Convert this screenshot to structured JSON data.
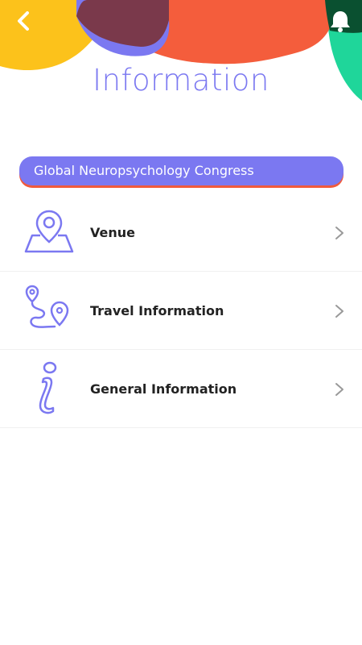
{
  "header": {
    "title": "Information",
    "colors": {
      "yellow": "#fcc21b",
      "orange": "#f45d3c",
      "purple": "#7b78f1",
      "dark": "#7a2e2e",
      "green": "#1fd69a",
      "dark_green": "#0a5030"
    },
    "back_icon": "chevron-left-icon",
    "notification_icon": "bell-icon"
  },
  "event": {
    "name": "Global Neuropsychology Congress",
    "accent": "#7b78f1",
    "underline": "#f05a3c"
  },
  "menu": {
    "items": [
      {
        "label": "Venue",
        "icon": "map-pin-icon"
      },
      {
        "label": "Travel Information",
        "icon": "route-icon"
      },
      {
        "label": "General Information",
        "icon": "info-icon"
      }
    ]
  }
}
